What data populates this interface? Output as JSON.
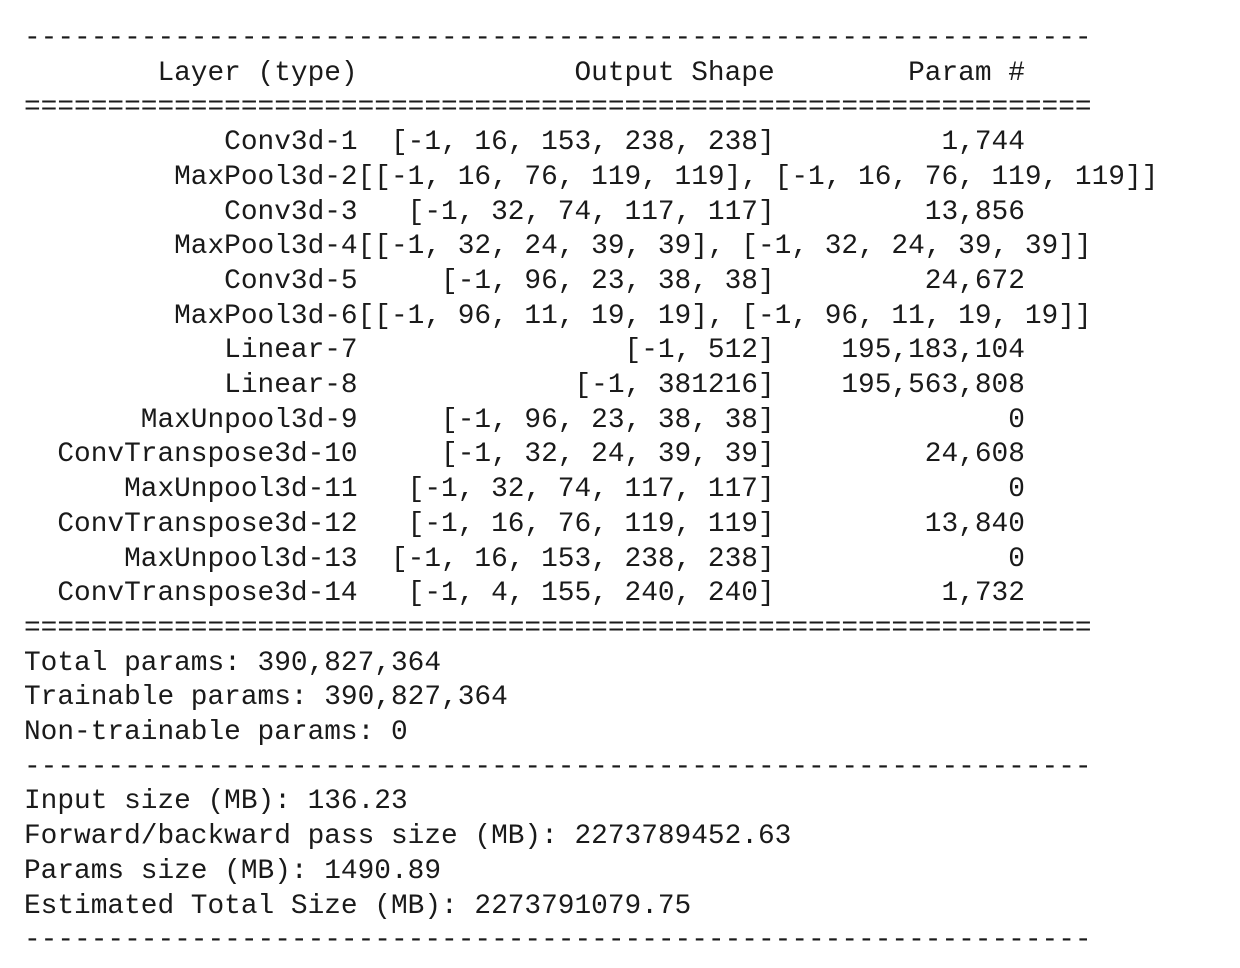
{
  "separators": {
    "dash": "----------------------------------------------------------------",
    "equals": "================================================================"
  },
  "header": {
    "layer": "Layer (type)",
    "output_shape": "Output Shape",
    "param": "Param #"
  },
  "layers": [
    {
      "name": "Conv3d-1",
      "shape": "[-1, 16, 153, 238, 238]",
      "params": "1,744"
    },
    {
      "name": "MaxPool3d-2",
      "shape": "[[-1, 16, 76, 119, 119], [-1, 16, 76, 119, 119]]",
      "params": ""
    },
    {
      "name": "Conv3d-3",
      "shape": "[-1, 32, 74, 117, 117]",
      "params": "13,856"
    },
    {
      "name": "MaxPool3d-4",
      "shape": "[[-1, 32, 24, 39, 39], [-1, 32, 24, 39, 39]]",
      "params": ""
    },
    {
      "name": "Conv3d-5",
      "shape": "[-1, 96, 23, 38, 38]",
      "params": "24,672"
    },
    {
      "name": "MaxPool3d-6",
      "shape": "[[-1, 96, 11, 19, 19], [-1, 96, 11, 19, 19]]",
      "params": ""
    },
    {
      "name": "Linear-7",
      "shape": "[-1, 512]",
      "params": "195,183,104"
    },
    {
      "name": "Linear-8",
      "shape": "[-1, 381216]",
      "params": "195,563,808"
    },
    {
      "name": "MaxUnpool3d-9",
      "shape": "[-1, 96, 23, 38, 38]",
      "params": "0"
    },
    {
      "name": "ConvTranspose3d-10",
      "shape": "[-1, 32, 24, 39, 39]",
      "params": "24,608"
    },
    {
      "name": "MaxUnpool3d-11",
      "shape": "[-1, 32, 74, 117, 117]",
      "params": "0"
    },
    {
      "name": "ConvTranspose3d-12",
      "shape": "[-1, 16, 76, 119, 119]",
      "params": "13,840"
    },
    {
      "name": "MaxUnpool3d-13",
      "shape": "[-1, 16, 153, 238, 238]",
      "params": "0"
    },
    {
      "name": "ConvTranspose3d-14",
      "shape": "[-1, 4, 155, 240, 240]",
      "params": "1,732"
    }
  ],
  "totals": {
    "total_params": "Total params: 390,827,364",
    "trainable_params": "Trainable params: 390,827,364",
    "non_trainable_params": "Non-trainable params: 0"
  },
  "sizes": {
    "input_size": "Input size (MB): 136.23",
    "forward_backward_size": "Forward/backward pass size (MB): 2273789452.63",
    "params_size": "Params size (MB): 1490.89",
    "estimated_total_size": "Estimated Total Size (MB): 2273791079.75"
  }
}
